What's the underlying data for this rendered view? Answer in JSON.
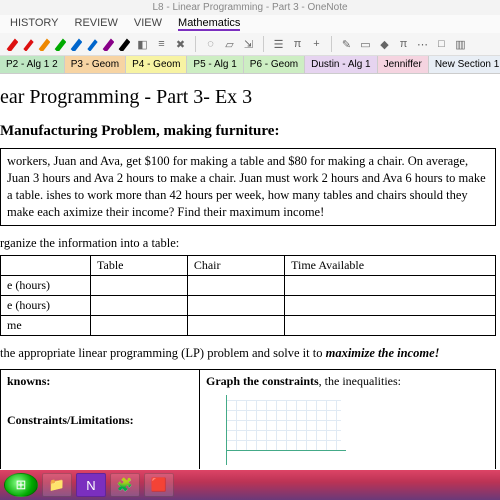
{
  "window": {
    "title": "L8 - Linear Programming - Part 3 - OneNote"
  },
  "menus": [
    "HISTORY",
    "REVIEW",
    "VIEW",
    "Mathematics"
  ],
  "pens": [
    {
      "color": "#d11",
      "thick": 2
    },
    {
      "color": "#d11",
      "thick": 1
    },
    {
      "color": "#e80",
      "thick": 2
    },
    {
      "color": "#0a0",
      "thick": 2
    },
    {
      "color": "#06c",
      "thick": 2
    },
    {
      "color": "#06c",
      "thick": 1
    },
    {
      "color": "#808",
      "thick": 2
    },
    {
      "color": "#000",
      "thick": 2
    }
  ],
  "ribbon_icons": {
    "color": "Color",
    "thickness": "Thickness",
    "delete_pen": "Delete Pen",
    "lasso": "Lasso",
    "eraser": "Eraser",
    "space": "Space",
    "math1": "Math",
    "pi": "π",
    "plus": "+",
    "highlighter": "Highlighter",
    "ruler": "Ruler",
    "shapes": "Shapes",
    "math2": "Math",
    "ink_math": "π",
    "more1": "⋯",
    "more2": "□",
    "more3": "▥"
  },
  "tabs": [
    {
      "label": "P2 - Alg 1 2",
      "bg": "#bfe7c3"
    },
    {
      "label": "P3 - Geom",
      "bg": "#f7d4a3"
    },
    {
      "label": "P4 - Geom",
      "bg": "#f7f3a3"
    },
    {
      "label": "P5 - Alg 1",
      "bg": "#cdeec3"
    },
    {
      "label": "P6 - Geom",
      "bg": "#cdeec3"
    },
    {
      "label": "Dustin - Alg 1",
      "bg": "#e6d4f0"
    },
    {
      "label": "Jenniffer",
      "bg": "#f5d4e0"
    },
    {
      "label": "New Section 1",
      "bg": "#e8eef5"
    }
  ],
  "doc": {
    "title": "ear Programming - Part 3- Ex 3",
    "heading": "Manufacturing Problem, making furniture:",
    "problem": "workers, Juan and Ava, get $100 for making a table and $80 for making a chair.  On average, Juan 3 hours and Ava 2 hours to make a chair.  Juan must work 2 hours and Ava 6 hours to make a table.  ishes to work more than 42 hours per week, how many tables and chairs should they make each aximize their income?  Find their maximum income!",
    "step1": "rganize the information into a table:",
    "table": {
      "headers": [
        "",
        "Table",
        "Chair",
        "Time Available"
      ],
      "rows": [
        "e (hours)",
        "e (hours)",
        "me"
      ]
    },
    "solve_prefix": "the appropriate linear programming (LP) problem and solve it to ",
    "solve_em": "maximize the income!",
    "left_label": "knowns:",
    "left_sub": "Constraints/Limitations:",
    "right_label_b": "Graph the constraints",
    "right_label_rest": ", the inequalities:"
  },
  "taskbar": {
    "start": "⊞",
    "items": [
      "📁",
      "N",
      "🧩",
      "🟥"
    ]
  }
}
